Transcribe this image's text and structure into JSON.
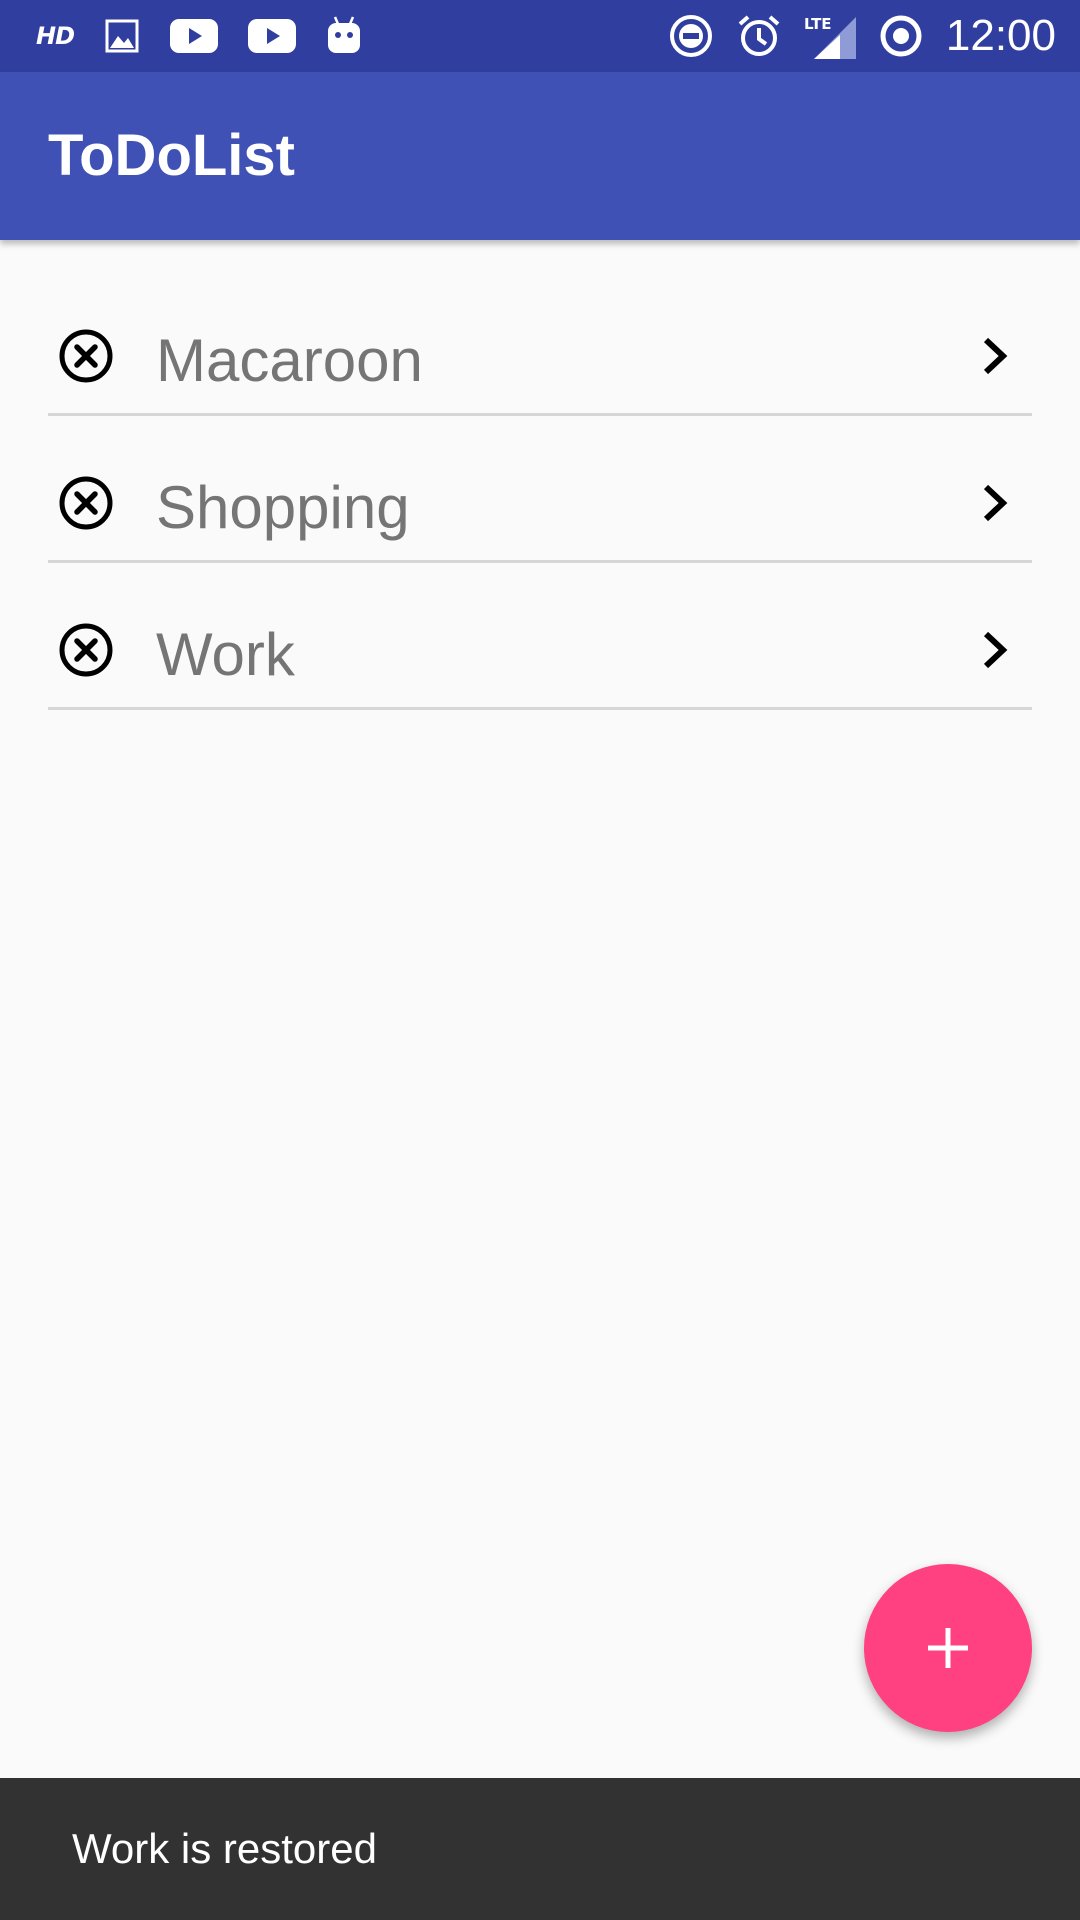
{
  "status_bar": {
    "hd_label": "HD",
    "lte_label": "LTE",
    "time": "12:00",
    "color": "#303f9f",
    "left_icons": [
      "hd-icon",
      "image-icon",
      "youtube-icon",
      "youtube-icon",
      "android-icon"
    ],
    "right_icons": [
      "do-not-disturb-icon",
      "alarm-icon",
      "lte-signal-icon",
      "battery-icon"
    ]
  },
  "app_bar": {
    "title": "ToDoList",
    "color": "#3f51b5"
  },
  "lists": [
    {
      "label": "Macaroon",
      "delete_icon": "cancel-circle-icon",
      "open_icon": "chevron-right-icon"
    },
    {
      "label": "Shopping",
      "delete_icon": "cancel-circle-icon",
      "open_icon": "chevron-right-icon"
    },
    {
      "label": "Work",
      "delete_icon": "cancel-circle-icon",
      "open_icon": "chevron-right-icon"
    }
  ],
  "fab": {
    "icon": "plus-icon",
    "color": "#ff4081"
  },
  "snackbar": {
    "message": "Work is restored",
    "color": "#323232"
  }
}
